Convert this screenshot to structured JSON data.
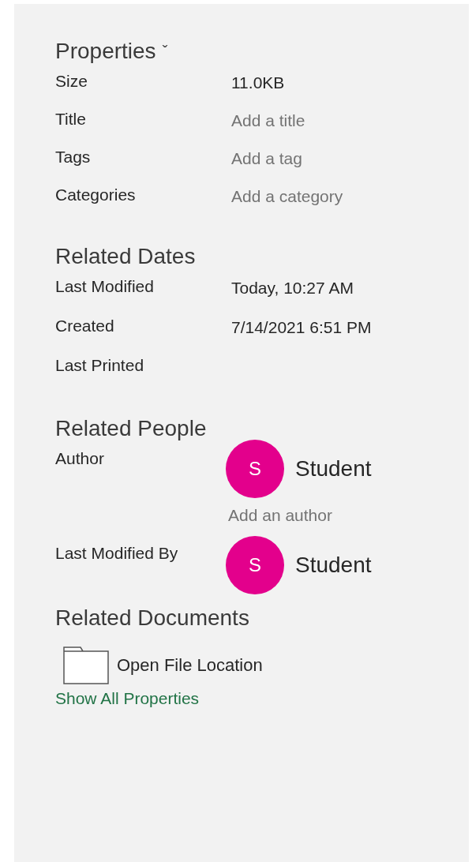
{
  "properties": {
    "title": "Properties",
    "caret": "ˇ",
    "rows": [
      {
        "label": "Size",
        "value": "11.0KB",
        "kind": "value"
      },
      {
        "label": "Title",
        "placeholder": "Add a title",
        "kind": "prompt"
      },
      {
        "label": "Tags",
        "placeholder": "Add a tag",
        "kind": "prompt"
      },
      {
        "label": "Categories",
        "placeholder": "Add a category",
        "kind": "prompt"
      }
    ]
  },
  "related_dates": {
    "title": "Related Dates",
    "rows": [
      {
        "label": "Last Modified",
        "value": "Today, 10:27 AM"
      },
      {
        "label": "Created",
        "value": "7/14/2021 6:51 PM"
      },
      {
        "label": "Last Printed"
      }
    ]
  },
  "related_people": {
    "title": "Related People",
    "rows": [
      {
        "label": "Author",
        "people": [
          {
            "initial": "S",
            "name": "Student",
            "color": "#e3008c"
          }
        ],
        "add": "Add an author"
      },
      {
        "label": "Last Modified By",
        "people": [
          {
            "initial": "S",
            "name": "Student",
            "color": "#e3008c"
          }
        ]
      }
    ]
  },
  "related_documents": {
    "title": "Related Documents",
    "items": [
      {
        "label": "Open File Location"
      }
    ]
  },
  "footer_link": "Show All Properties"
}
